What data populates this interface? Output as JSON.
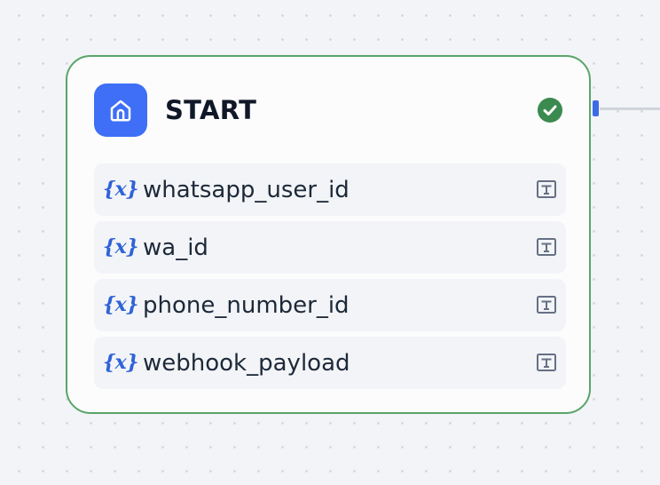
{
  "node": {
    "title": "START",
    "status_icon": "check-circle-icon",
    "header_icon": "home-icon",
    "variables": [
      {
        "icon": "{x}",
        "name": "whatsapp_user_id",
        "type_icon": "text-type-icon"
      },
      {
        "icon": "{x}",
        "name": "wa_id",
        "type_icon": "text-type-icon"
      },
      {
        "icon": "{x}",
        "name": "phone_number_id",
        "type_icon": "text-type-icon"
      },
      {
        "icon": "{x}",
        "name": "webhook_payload",
        "type_icon": "text-type-icon"
      }
    ]
  },
  "colors": {
    "accent": "#3e6ff6",
    "node_border": "#5aa469",
    "status_success": "#3b8a4f",
    "variable_icon": "#2f63d8"
  }
}
